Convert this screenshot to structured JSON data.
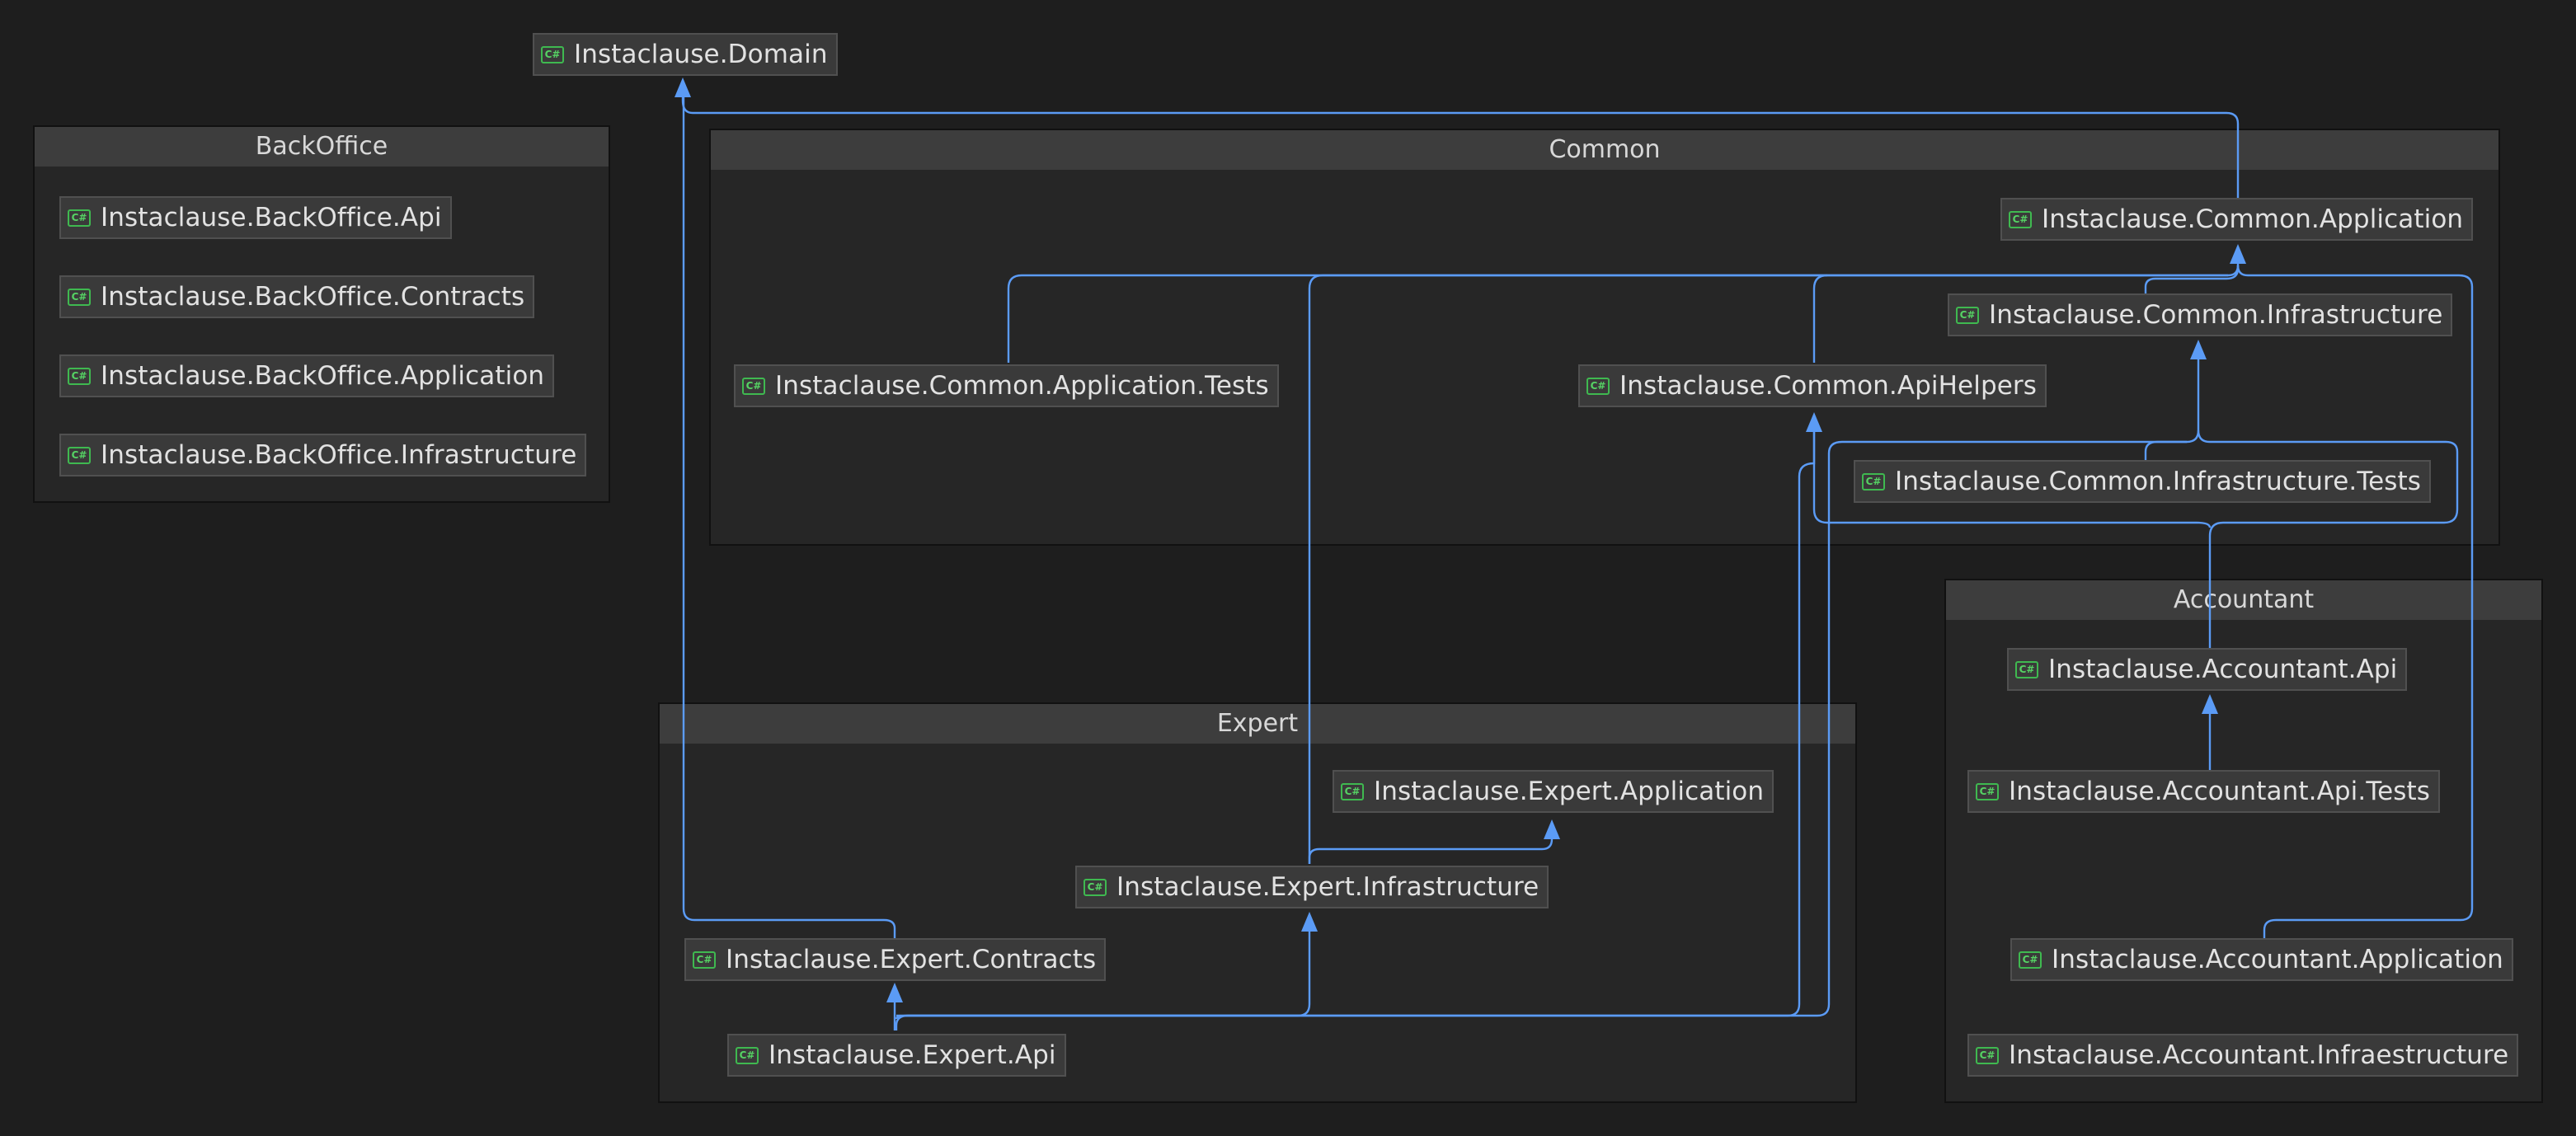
{
  "diagram": {
    "groups": {
      "backoffice": {
        "title": "BackOffice"
      },
      "common": {
        "title": "Common"
      },
      "accountant": {
        "title": "Accountant"
      },
      "expert": {
        "title": "Expert"
      }
    },
    "icon": {
      "name": "csharp-project-icon",
      "glyph": "C#"
    },
    "nodes": {
      "domain": "Instaclause.Domain",
      "bo_api": "Instaclause.BackOffice.Api",
      "bo_contracts": "Instaclause.BackOffice.Contracts",
      "bo_application": "Instaclause.BackOffice.Application",
      "bo_infrastructure": "Instaclause.BackOffice.Infrastructure",
      "common_application": "Instaclause.Common.Application",
      "common_infrastructure": "Instaclause.Common.Infrastructure",
      "common_application_tests": "Instaclause.Common.Application.Tests",
      "common_apihelpers": "Instaclause.Common.ApiHelpers",
      "common_infrastructure_tests": "Instaclause.Common.Infrastructure.Tests",
      "acc_api": "Instaclause.Accountant.Api",
      "acc_api_tests": "Instaclause.Accountant.Api.Tests",
      "acc_application": "Instaclause.Accountant.Application",
      "acc_infra": "Instaclause.Accountant.Infraestructure",
      "exp_application": "Instaclause.Expert.Application",
      "exp_infrastructure": "Instaclause.Expert.Infrastructure",
      "exp_contracts": "Instaclause.Expert.Contracts",
      "exp_api": "Instaclause.Expert.Api"
    },
    "edge_color": "#5b9bf5"
  }
}
